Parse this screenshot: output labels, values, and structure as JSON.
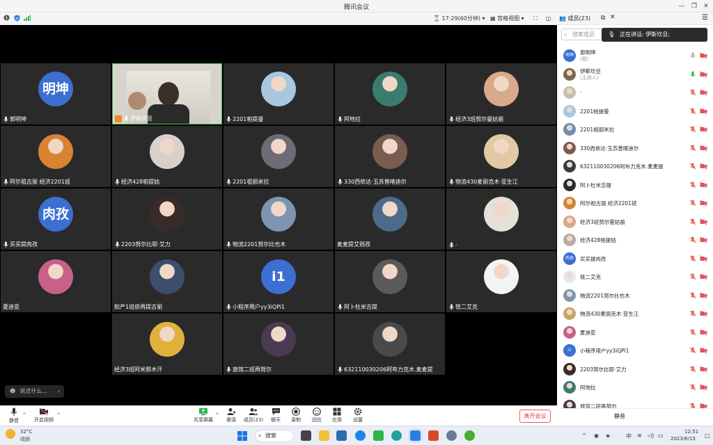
{
  "window": {
    "title": "腾讯会议"
  },
  "infobar": {
    "timer": "17:29(60分钟)",
    "view_mode": "宫格视图"
  },
  "members_header": {
    "label": "成员(23)"
  },
  "tiles": [
    {
      "name": "郭明坤",
      "avatar_text": "明坤",
      "color": "#3b6fd1"
    },
    {
      "name": "伊斯坎旦",
      "avatar_text": "",
      "color": "#c9c3b6"
    },
    {
      "name": "2201帕提曼",
      "avatar_text": "",
      "color": "#a7c8df"
    },
    {
      "name": "阿地拉",
      "avatar_text": "",
      "color": "#3a7d6e"
    },
    {
      "name": "经济3班努尔曼姑丽",
      "avatar_text": "",
      "color": "#d9a98b"
    },
    {
      "name": "阿尔祖古丽 经济2201班",
      "avatar_text": "",
      "color": "#d98232"
    },
    {
      "name": "经济428帕提姑",
      "avatar_text": "",
      "color": "#d9d0cc"
    },
    {
      "name": "2201祖丽米拉",
      "avatar_text": "",
      "color": "#6e6a76"
    },
    {
      "name": "330西依达·玉苏普喀迪尔",
      "avatar_text": "",
      "color": "#7a5c50"
    },
    {
      "name": "物流430麦丽克木·亚生江",
      "avatar_text": "",
      "color": "#e2c9a3"
    },
    {
      "name": "买买提肉孜",
      "avatar_text": "肉孜",
      "color": "#3b6fd1"
    },
    {
      "name": "2203努尔比耶·艾力",
      "avatar_text": "",
      "color": "#3a2a2a"
    },
    {
      "name": "物流2201努尔比也木",
      "avatar_text": "",
      "color": "#7d95b3"
    },
    {
      "name": "麦麦提艾则孜",
      "avatar_text": "",
      "color": "#4d6a8c"
    },
    {
      "name": "·",
      "avatar_text": "",
      "color": "#e5e0da"
    },
    {
      "name": "夏迪亚",
      "avatar_text": "",
      "color": "#c9608a"
    },
    {
      "name": "知产1班依再提古丽",
      "avatar_text": "",
      "color": "#3c4d6e"
    },
    {
      "name": "小程序用户yy3iQPi1",
      "avatar_text": "i1",
      "color": "#3b6fd1"
    },
    {
      "name": "阿卜杜米吉提",
      "avatar_text": "",
      "color": "#5a5a5a"
    },
    {
      "name": "铣二艾克",
      "avatar_text": "",
      "color": "#f4f4f4"
    },
    {
      "name": "经济3班阿米那木汗",
      "avatar_text": "",
      "color": "#e0b23c"
    },
    {
      "name": "旅馆二班再努尔",
      "avatar_text": "",
      "color": "#4a3a52"
    },
    {
      "name": "632110030206阿布力克木.麦麦提",
      "avatar_text": "",
      "color": "#4a4a4a"
    }
  ],
  "chat": {
    "placeholder": "说点什么..."
  },
  "toolbar": {
    "mute": "静音",
    "video": "开启视频",
    "share": "共享屏幕",
    "invite": "邀请",
    "members": "成员(23)",
    "chat": "聊天",
    "record": "录制",
    "playback": "回应",
    "apps": "应用",
    "settings": "设置",
    "leave": "离开会议"
  },
  "panel": {
    "search_placeholder": "搜索成员",
    "speaking": "正在讲话: 伊斯坎旦;"
  },
  "members": [
    {
      "name": "郭明坤",
      "role": "(我)",
      "avatar_text": "明坤",
      "color": "#3b6fd1",
      "mic": "off-gray"
    },
    {
      "name": "伊斯坎旦",
      "role": "(主持人)",
      "avatar_text": "",
      "color": "#7a6a50",
      "mic": "on"
    },
    {
      "name": "·",
      "role": "",
      "avatar_text": "",
      "color": "#c7bfb0",
      "mic": "off"
    },
    {
      "name": "2201帕提曼",
      "role": "",
      "avatar_text": "",
      "color": "#a7c8df",
      "mic": "off"
    },
    {
      "name": "2201祖丽米拉",
      "role": "",
      "avatar_text": "",
      "color": "#6e8fb0",
      "mic": "off"
    },
    {
      "name": "330西依达·玉苏普喀迪尔",
      "role": "",
      "avatar_text": "",
      "color": "#7a5c50",
      "mic": "off"
    },
    {
      "name": "632110030206阿布力克木.麦麦提",
      "role": "",
      "avatar_text": "",
      "color": "#3a3a3a",
      "mic": "off"
    },
    {
      "name": "阿卜杜米吉提",
      "role": "",
      "avatar_text": "",
      "color": "#2b2b2b",
      "mic": "off"
    },
    {
      "name": "阿尔祖古丽 经济2201班",
      "role": "",
      "avatar_text": "",
      "color": "#d98232",
      "mic": "off"
    },
    {
      "name": "经济3班努尔曼姑丽",
      "role": "",
      "avatar_text": "",
      "color": "#d9a98b",
      "mic": "off"
    },
    {
      "name": "经济428帕提姑",
      "role": "",
      "avatar_text": "",
      "color": "#b9aaa5",
      "mic": "off"
    },
    {
      "name": "买买提肉孜",
      "role": "",
      "avatar_text": "肉孜",
      "color": "#3b6fd1",
      "mic": "off"
    },
    {
      "name": "铣二艾克",
      "role": "",
      "avatar_text": "",
      "color": "#e9e9e9",
      "mic": "off"
    },
    {
      "name": "物流2201努尔比也木",
      "role": "",
      "avatar_text": "",
      "color": "#7d95b3",
      "mic": "off"
    },
    {
      "name": "物流430麦丽克木·亚生江",
      "role": "",
      "avatar_text": "",
      "color": "#c9a46a",
      "mic": "off"
    },
    {
      "name": "夏迪亚",
      "role": "",
      "avatar_text": "",
      "color": "#c9608a",
      "mic": "off"
    },
    {
      "name": "小程序用户yy3iQPi1",
      "role": "",
      "avatar_text": "i1",
      "color": "#3b6fd1",
      "mic": "off"
    },
    {
      "name": "2203努尔比耶·艾力",
      "role": "",
      "avatar_text": "",
      "color": "#3a2a2a",
      "mic": "off"
    },
    {
      "name": "阿地拉",
      "role": "",
      "avatar_text": "",
      "color": "#3a7d6e",
      "mic": "off"
    },
    {
      "name": "旅馆二班再努尔",
      "role": "",
      "avatar_text": "",
      "color": "#4a3a52",
      "mic": "off"
    }
  ],
  "panel_footer": {
    "mute_all": "静音"
  },
  "taskbar": {
    "temp": "32°C",
    "weather": "晴朗",
    "search": "搜索",
    "time": "12:51",
    "date": "2023/6/15",
    "ime": "中"
  }
}
